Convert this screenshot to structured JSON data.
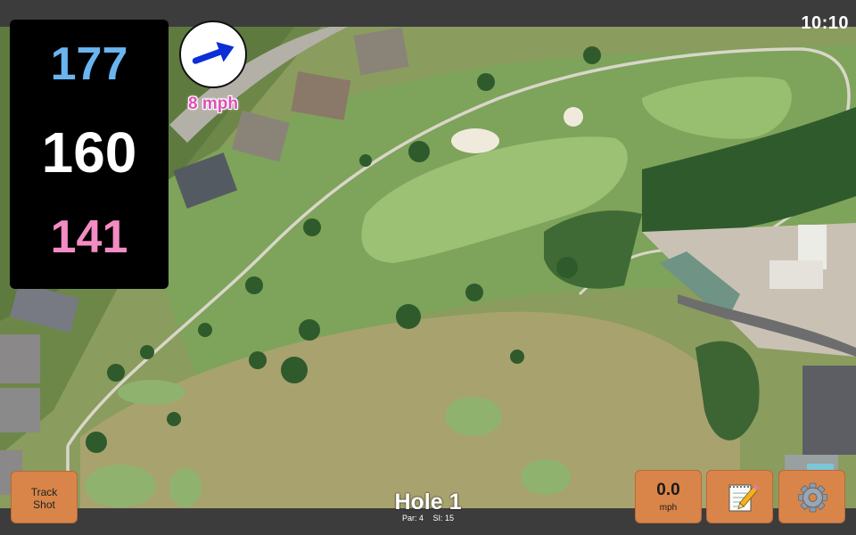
{
  "status": {
    "clock": "10:10"
  },
  "distances": {
    "back": "177",
    "middle": "160",
    "front": "141"
  },
  "wind": {
    "speed": "8 mph",
    "direction_icon": "arrow-right-icon"
  },
  "buttons": {
    "track_line1": "Track",
    "track_line2": "Shot",
    "speed_value": "0.0",
    "speed_unit": "mph",
    "notes_icon": "notepad-icon",
    "settings_icon": "gear-icon"
  },
  "hole": {
    "title": "Hole 1",
    "par": "Par: 4",
    "si": "SI: 15"
  },
  "colors": {
    "back": "#6ab4f0",
    "middle": "#ffffff",
    "front": "#f28cc2",
    "wind_text": "#e04fb8",
    "button": "#d98549"
  }
}
